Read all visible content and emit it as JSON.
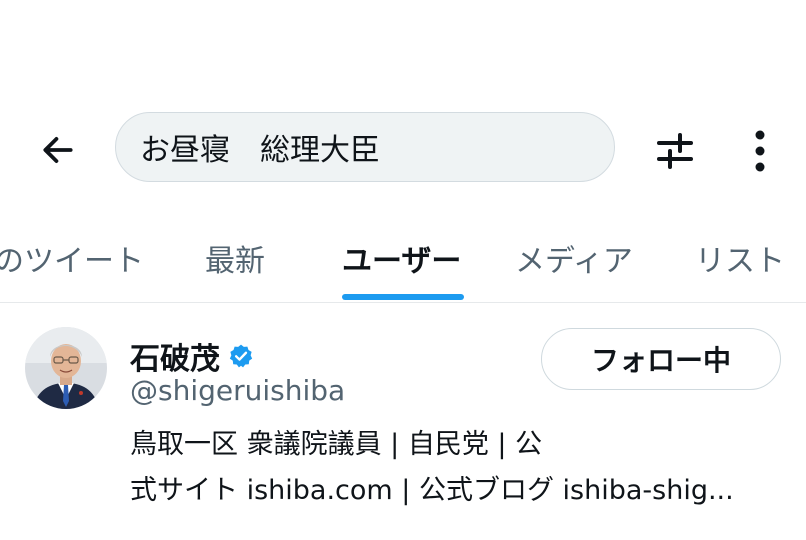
{
  "header": {
    "search_value": "お昼寝　総理大臣",
    "back_icon": "arrow-left-icon",
    "filter_icon": "sliders-icon",
    "more_icon": "more-vertical-icon"
  },
  "tabs": [
    {
      "label": "のツイート",
      "active": false
    },
    {
      "label": "最新",
      "active": false
    },
    {
      "label": "ユーザー",
      "active": true
    },
    {
      "label": "メディア",
      "active": false
    },
    {
      "label": "リスト",
      "active": false
    }
  ],
  "colors": {
    "accent": "#1d9bf0",
    "text": "#0f1419",
    "muted": "#536471",
    "search_bg": "#eff3f4"
  },
  "user": {
    "name": "石破茂",
    "handle": "@shigeruishiba",
    "follow_label": "フォロー中",
    "verified": true,
    "bio_line1": "鳥取一区 衆議院議員 | 自民党 | 公",
    "bio_line2": "式サイト ishiba.com | 公式ブログ ishiba-shig..."
  }
}
